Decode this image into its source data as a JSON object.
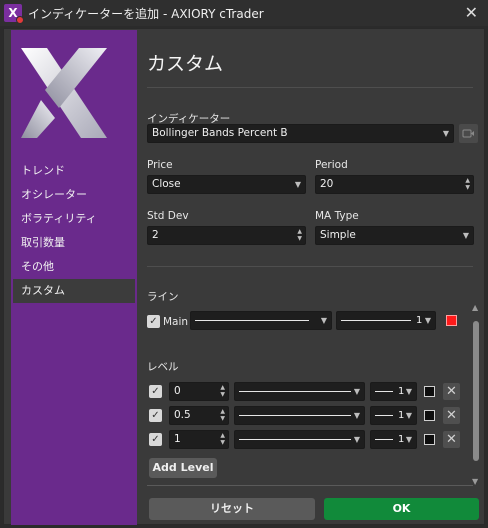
{
  "window": {
    "title": "インディケーターを追加 - AXIORY cTrader",
    "app_icon": "X",
    "close_glyph": "✕"
  },
  "sidebar": {
    "items": [
      {
        "label": "トレンド"
      },
      {
        "label": "オシレーター"
      },
      {
        "label": "ボラティリティ"
      },
      {
        "label": "取引数量"
      },
      {
        "label": "その他"
      },
      {
        "label": "カスタム",
        "active": true
      }
    ]
  },
  "main": {
    "heading": "カスタム",
    "indicator_label": "インディケーター",
    "indicator_value": "Bollinger Bands Percent B",
    "source_label": "Price",
    "source_value": "Close",
    "period_label": "Period",
    "period_value": "20",
    "stddev_label": "Std Dev",
    "stddev_value": "2",
    "matype_label": "MA Type",
    "matype_value": "Simple"
  },
  "lines": {
    "section_label": "ライン",
    "main_label": "Main",
    "main_thickness": "1",
    "main_color": "#ff1a1a"
  },
  "levels": {
    "section_label": "レベル",
    "items": [
      {
        "value": "0",
        "thickness": "1"
      },
      {
        "value": "0.5",
        "thickness": "1"
      },
      {
        "value": "1",
        "thickness": "1"
      }
    ],
    "add_label": "Add Level"
  },
  "footer": {
    "reset_label": "リセット",
    "ok_label": "OK"
  },
  "colors": {
    "sidebar": "#6a2a8c",
    "ok": "#118a3a"
  }
}
